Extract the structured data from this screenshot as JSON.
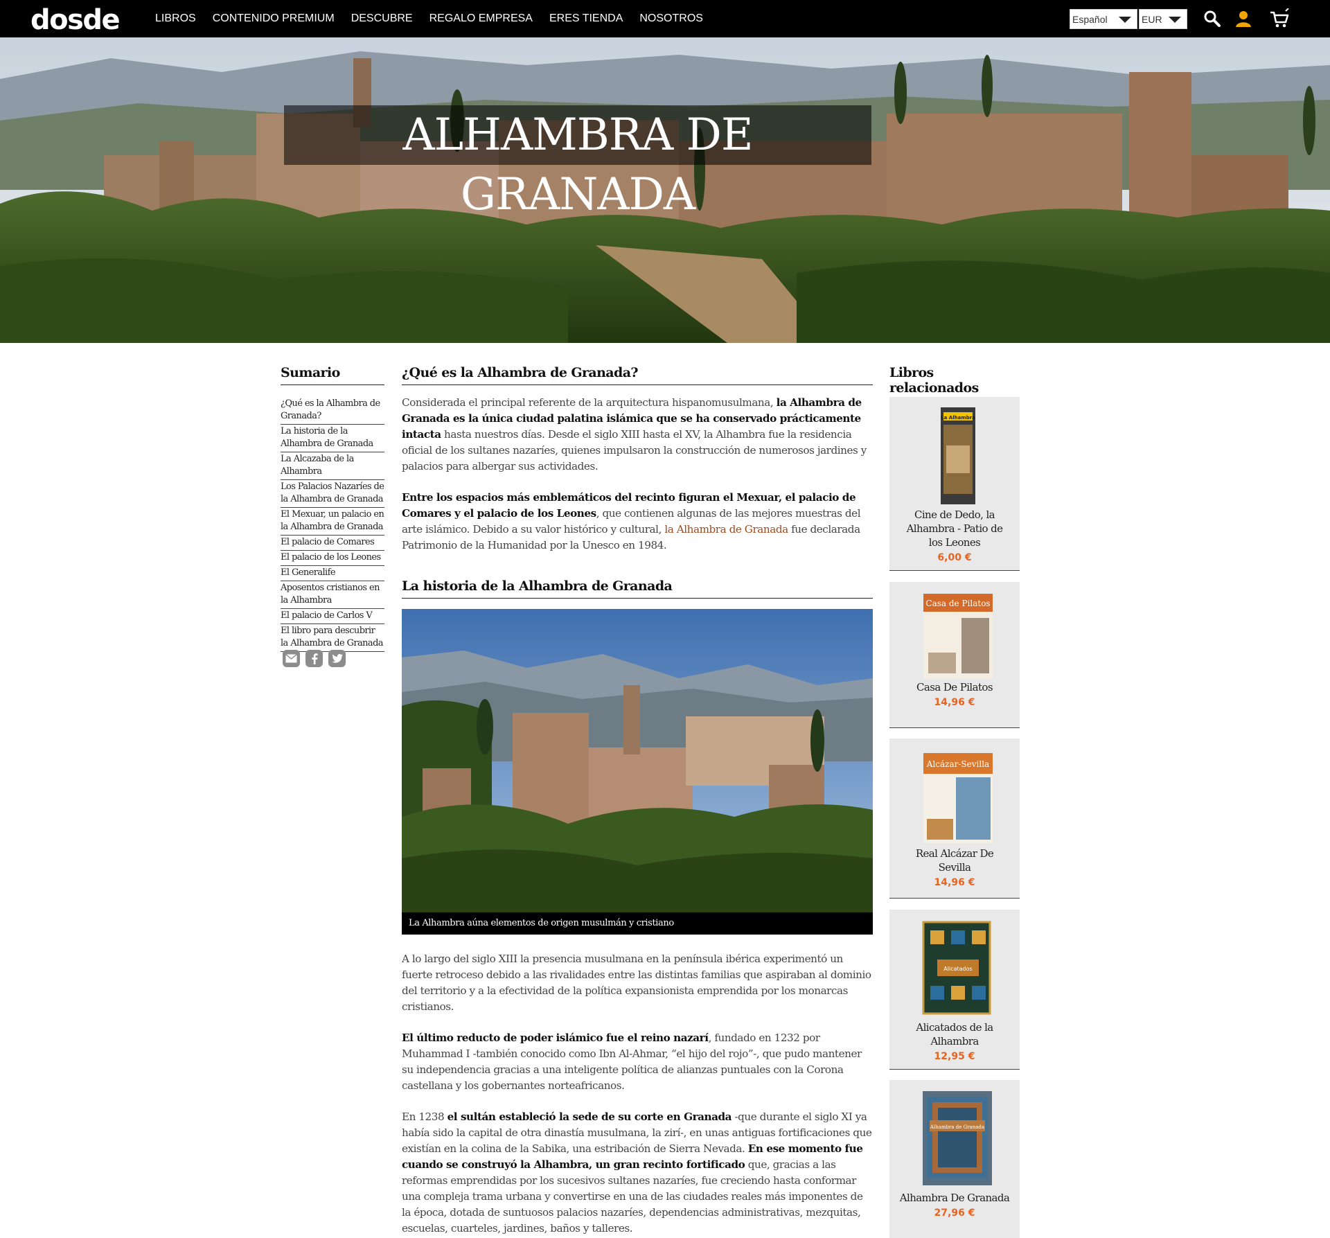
{
  "header": {
    "logo": "dosde",
    "nav": [
      "LIBROS",
      "CONTENIDO PREMIUM",
      "DESCUBRE",
      "REGALO EMPRESA",
      "ERES TIENDA",
      "NOSOTROS"
    ],
    "language": "Español",
    "currency": "EUR",
    "icons": [
      "search-icon",
      "user-icon",
      "cart-icon"
    ]
  },
  "hero": {
    "title": "ALHAMBRA DE GRANADA"
  },
  "sidebar": {
    "title": "Sumario",
    "items": [
      "¿Qué es la Alhambra de Granada?",
      "La historia de la Alhambra de Granada",
      "La Alcazaba de la Alhambra",
      "Los Palacios Nazaríes de la Alhambra de Granada",
      "El Mexuar, un palacio en la Alhambra de Granada",
      "El palacio de Comares",
      "El palacio de los Leones",
      "El Generalife",
      "Aposentos cristianos en la Alhambra",
      "El palacio de Carlos V",
      "El libro para descubrir la Alhambra de Granada"
    ],
    "share_icons": [
      "mail-icon",
      "facebook-icon",
      "twitter-icon"
    ]
  },
  "article": {
    "section1": {
      "heading": "¿Qué es la Alhambra de Granada?",
      "p1_a": "Considerada el principal referente de la arquitectura hispanomusulmana, ",
      "p1_b": "la Alhambra de Granada es la única ciudad palatina islámica que se ha conservado prácticamente intacta",
      "p1_c": " hasta nuestros días. Desde el siglo XIII hasta el XV, la Alhambra fue la residencia oficial de los sultanes nazaríes, quienes impulsaron la construcción de numerosos jardines y palacios para albergar sus actividades.",
      "p2_a": "Entre los espacios más emblemáticos del recinto figuran el Mexuar, el palacio de Comares y el palacio de los Leones",
      "p2_b": ", que contienen algunas de las mejores muestras del arte islámico. Debido a su valor histórico y cultural, ",
      "p2_link": "la Alhambra de Granada",
      "p2_c": " fue declarada Patrimonio de la Humanidad por la Unesco en 1984."
    },
    "section2": {
      "heading": "La historia de la Alhambra de Granada",
      "image_caption": "La Alhambra aúna elementos de origen musulmán y cristiano",
      "p1": "A lo largo del siglo XIII la presencia musulmana en la península ibérica experimentó un fuerte retroceso debido a las rivalidades entre las distintas familias que aspiraban al dominio del territorio y a la efectividad de la política expansionista emprendida por los monarcas cristianos.",
      "p2_a": "El último reducto de poder islámico fue el reino nazarí",
      "p2_b": ", fundado en 1232 por Muhammad I -también conocido como Ibn Al-Ahmar, “el hijo del rojo”-, que pudo mantener su independencia gracias a una inteligente política de alianzas puntuales con la Corona castellana y los gobernantes norteafricanos.",
      "p3_a": "En 1238 ",
      "p3_b": "el sultán estableció la sede de su corte en Granada",
      "p3_c": " -que durante el siglo XI ya había sido la capital de otra dinastía musulmana, la zirí-, en unas antiguas fortificaciones que existían en la colina de la Sabika, una estribación de Sierra Nevada. ",
      "p3_d": "En ese momento fue cuando se construyó la Alhambra, un gran recinto fortificado",
      "p3_e": " que, gracias a las reformas emprendidas por los sucesivos sultanes nazaríes, fue creciendo hasta conformar una compleja trama urbana y convertirse en una de las ciudades reales más imponentes de la época, dotada de suntuosos palacios nazaríes, dependencias administrativas, mezquitas, escuelas, cuarteles, jardines, baños y talleres."
    }
  },
  "related": {
    "title": "Libros relacionados",
    "books": [
      {
        "title": "Cine de Dedo, la Alhambra - Patio de los Leones",
        "price": "6,00 €",
        "cover_text": "La Alhambra"
      },
      {
        "title": "Casa De Pilatos",
        "price": "14,96 €",
        "cover_text": "Casa de Pilatos"
      },
      {
        "title": "Real Alcázar De Sevilla",
        "price": "14,96 €",
        "cover_text": "Alcázar-Sevilla"
      },
      {
        "title": "Alicatados de la Alhambra",
        "price": "12,95 €",
        "cover_text": "Alicatados"
      },
      {
        "title": "Alhambra De Granada",
        "price": "27,96 €",
        "cover_text": "Alhambra de Granada"
      }
    ]
  },
  "colors": {
    "topbar": "#000000",
    "price": "#e8631f",
    "link": "#9a4a1e",
    "card_bg": "#e9e9e9"
  }
}
